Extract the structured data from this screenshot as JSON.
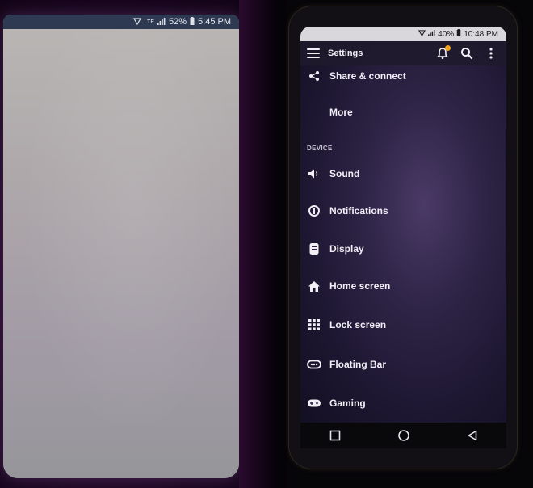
{
  "left_phone": {
    "status_bar": {
      "signal_label": "LTE",
      "battery": "52%",
      "time": "5:45 PM"
    }
  },
  "right_phone": {
    "status_bar": {
      "battery": "40%",
      "time": "10:48 PM"
    },
    "app_bar": {
      "title": "Settings",
      "icons": [
        "menu-icon",
        "bell-icon",
        "search-icon",
        "more-vert-icon"
      ]
    },
    "items_top": [
      {
        "label": "Share & connect",
        "icon": "share-icon"
      },
      {
        "label": "More",
        "icon": ""
      }
    ],
    "section_header": "DEVICE",
    "items_device": [
      {
        "label": "Sound",
        "icon": "speaker-icon"
      },
      {
        "label": "Notifications",
        "icon": "notification-icon"
      },
      {
        "label": "Display",
        "icon": "display-icon"
      },
      {
        "label": "Home screen",
        "icon": "home-icon"
      },
      {
        "label": "Lock screen",
        "icon": "grid-icon"
      },
      {
        "label": "Floating Bar",
        "icon": "floating-bar-icon"
      },
      {
        "label": "Gaming",
        "icon": "gamepad-icon"
      }
    ],
    "nav_bar": [
      "recents-icon",
      "home-circle-icon",
      "back-icon"
    ]
  }
}
